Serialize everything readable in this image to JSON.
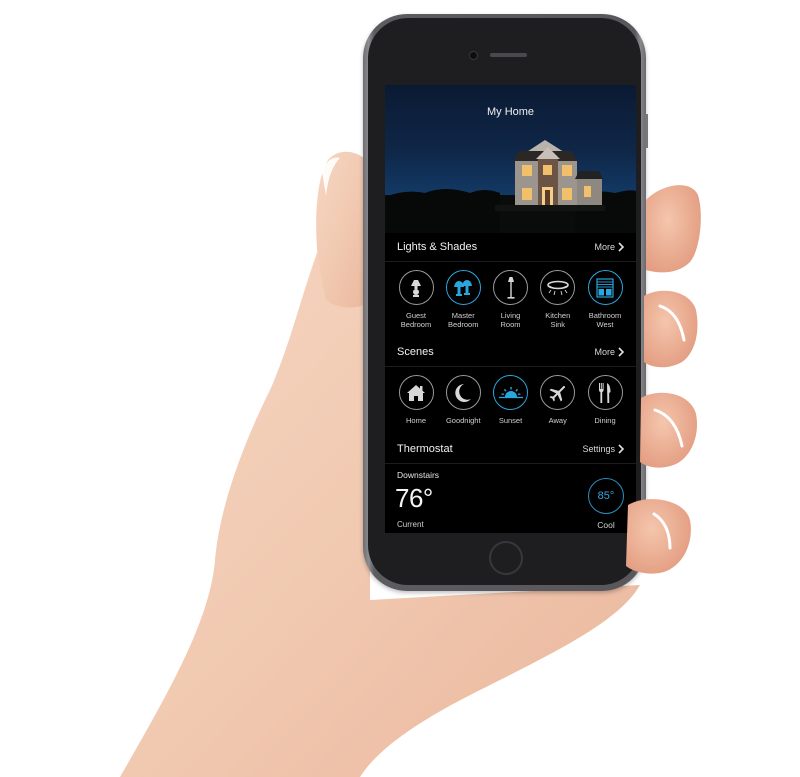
{
  "app": {
    "title": "My Home"
  },
  "lights_and_shades": {
    "title": "Lights & Shades",
    "link_label": "More",
    "items": [
      {
        "label_line1": "Guest",
        "label_line2": "Bedroom",
        "icon": "table-lamp-icon",
        "active": false
      },
      {
        "label_line1": "Master",
        "label_line2": "Bedroom",
        "icon": "twin-lamps-icon",
        "active": true
      },
      {
        "label_line1": "Living",
        "label_line2": "Room",
        "icon": "floor-lamp-icon",
        "active": false
      },
      {
        "label_line1": "Kitchen",
        "label_line2": "Sink",
        "icon": "ceiling-light-icon",
        "active": false
      },
      {
        "label_line1": "Bathroom",
        "label_line2": "West",
        "icon": "window-shade-icon",
        "active": true
      }
    ]
  },
  "scenes": {
    "title": "Scenes",
    "link_label": "More",
    "items": [
      {
        "label": "Home",
        "icon": "house-icon",
        "active": false
      },
      {
        "label": "Goodnight",
        "icon": "moon-icon",
        "active": false
      },
      {
        "label": "Sunset",
        "icon": "sunset-icon",
        "active": true
      },
      {
        "label": "Away",
        "icon": "airplane-icon",
        "active": false
      },
      {
        "label": "Dining",
        "icon": "fork-knife-icon",
        "active": false
      }
    ]
  },
  "thermostat": {
    "title": "Thermostat",
    "link_label": "Settings",
    "zone": "Downstairs",
    "current_temp": "76°",
    "current_label": "Current",
    "setpoint": "85°",
    "mode": "Cool",
    "pages_total": 2,
    "page_active": 1
  },
  "colors": {
    "accent": "#2aa6de",
    "screen_bg": "#000000",
    "inactive_ring": "#9a9a9c"
  }
}
